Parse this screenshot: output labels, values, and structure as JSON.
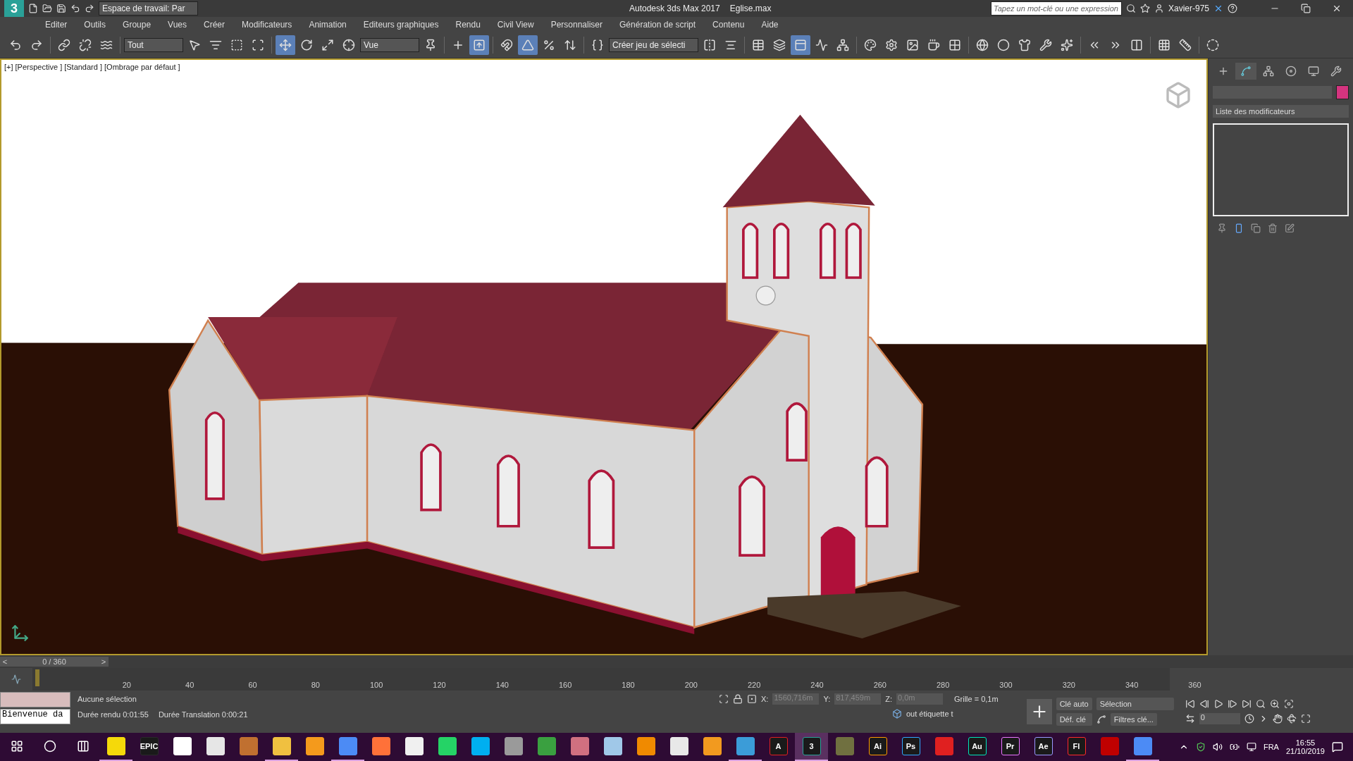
{
  "title_bar": {
    "logo": "3",
    "workspace": "Espace de travail: Par",
    "app_title": "Autodesk 3ds Max 2017",
    "file_name": "Eglise.max",
    "search": {
      "placeholder": "Tapez un mot-clé ou une expression"
    },
    "user": "Xavier-975"
  },
  "menu": [
    "Editer",
    "Outils",
    "Groupe",
    "Vues",
    "Créer",
    "Modificateurs",
    "Animation",
    "Editeurs graphiques",
    "Rendu",
    "Civil View",
    "Personnaliser",
    "Génération de script",
    "Contenu",
    "Aide"
  ],
  "toolbar": [
    {
      "kind": "undo",
      "selected": false
    },
    {
      "kind": "redo",
      "selected": false
    },
    {
      "kind": "sep"
    },
    {
      "kind": "link",
      "selected": false
    },
    {
      "kind": "unlink",
      "selected": false
    },
    {
      "kind": "bind",
      "selected": false
    },
    {
      "kind": "sep"
    },
    {
      "kind": "dropdown",
      "label": "Tout"
    },
    {
      "kind": "select",
      "selected": false
    },
    {
      "kind": "selectname",
      "selected": false
    },
    {
      "kind": "region",
      "selected": false
    },
    {
      "kind": "window",
      "selected": false
    },
    {
      "kind": "sep"
    },
    {
      "kind": "move",
      "selected": true
    },
    {
      "kind": "rotate",
      "selected": false
    },
    {
      "kind": "scale",
      "selected": false
    },
    {
      "kind": "place",
      "selected": false
    },
    {
      "kind": "dropdown",
      "label": "Vue"
    },
    {
      "kind": "pivot",
      "selected": false
    },
    {
      "kind": "sep"
    },
    {
      "kind": "manipulate",
      "selected": false
    },
    {
      "kind": "keyboard",
      "selected": true
    },
    {
      "kind": "sep"
    },
    {
      "kind": "snap",
      "selected": false
    },
    {
      "kind": "angle",
      "selected": true
    },
    {
      "kind": "percent",
      "selected": false
    },
    {
      "kind": "spinner",
      "selected": false
    },
    {
      "kind": "sep"
    },
    {
      "kind": "named",
      "selected": false
    },
    {
      "kind": "dropdown",
      "label": "Créer jeu de sélecti"
    },
    {
      "kind": "mirror",
      "selected": false
    },
    {
      "kind": "align",
      "selected": false
    },
    {
      "kind": "sep"
    },
    {
      "kind": "explorer",
      "selected": false
    },
    {
      "kind": "layers",
      "selected": false
    },
    {
      "kind": "ribbon",
      "selected": true
    },
    {
      "kind": "curve",
      "selected": false
    },
    {
      "kind": "schematic",
      "selected": false
    },
    {
      "kind": "sep"
    },
    {
      "kind": "material",
      "selected": false
    },
    {
      "kind": "rendersetup",
      "selected": false
    },
    {
      "kind": "frame",
      "selected": false
    },
    {
      "kind": "render",
      "selected": false
    },
    {
      "kind": "grid",
      "selected": false
    },
    {
      "kind": "sep"
    },
    {
      "kind": "web",
      "selected": false
    },
    {
      "kind": "sphere",
      "selected": false
    },
    {
      "kind": "shirt",
      "selected": false
    },
    {
      "kind": "pipe",
      "selected": false
    },
    {
      "kind": "spark",
      "selected": false
    },
    {
      "kind": "sep"
    },
    {
      "kind": "clipin",
      "selected": false
    },
    {
      "kind": "clipout",
      "selected": false
    },
    {
      "kind": "clipmid",
      "selected": false
    },
    {
      "kind": "sep"
    },
    {
      "kind": "dots",
      "selected": false
    },
    {
      "kind": "ruler",
      "selected": false
    },
    {
      "kind": "sep"
    },
    {
      "kind": "circle",
      "selected": false
    }
  ],
  "viewport": {
    "labels": [
      "[+]",
      "[Perspective ]",
      "[Standard ]",
      "[Ombrage par défaut ]"
    ]
  },
  "command_panel": {
    "tabs": [
      {
        "kind": "create",
        "selected": false
      },
      {
        "kind": "modify",
        "selected": true
      },
      {
        "kind": "hierarchy",
        "selected": false
      },
      {
        "kind": "motion",
        "selected": false
      },
      {
        "kind": "display",
        "selected": false
      },
      {
        "kind": "utilities",
        "selected": false
      }
    ],
    "modifier_list": "Liste des modificateurs"
  },
  "time_slider": {
    "prev": "<",
    "position": "0 / 360",
    "next": ">"
  },
  "timeline": {
    "labels": [
      "20",
      "40",
      "60",
      "80",
      "100",
      "120",
      "140",
      "160",
      "180",
      "200",
      "220",
      "240",
      "260",
      "280",
      "300",
      "320",
      "340",
      "360"
    ]
  },
  "status": {
    "listener": "Bienvenue da",
    "selection": "Aucune sélection",
    "render_time": "Durée rendu  0:01:55",
    "translation_time": "Durée Translation  0:00:21",
    "x_label": "X:",
    "x": "1560,716m",
    "y_label": "Y:",
    "y": "817,459m",
    "z_label": "Z:",
    "z": "0,0m",
    "grid": "Grille = 0,1m",
    "tag": "out étiquette t",
    "auto_key": "Clé auto",
    "set_key": "Déf. clé",
    "key_mode": "Sélection",
    "key_filters": "Filtres clé...",
    "frame": "0"
  },
  "taskbar": {
    "apps": [
      {
        "color": "#f5d90a",
        "running": true
      },
      {
        "color": "#2a2a2a",
        "label": "EPIC",
        "running": false
      },
      {
        "color": "#ffffff",
        "running": false
      },
      {
        "color": "#e6e6e6",
        "running": false
      },
      {
        "color": "#c07030",
        "running": false
      },
      {
        "color": "#f0c040",
        "running": true
      },
      {
        "color": "#f49a1c",
        "running": false
      },
      {
        "color": "#4c8bf5",
        "running": true
      },
      {
        "color": "#ff7139",
        "running": false
      },
      {
        "color": "#f0f0f0",
        "running": false
      },
      {
        "color": "#25d366",
        "running": false
      },
      {
        "color": "#00aff0",
        "running": false
      },
      {
        "color": "#9a9a9a",
        "running": false
      },
      {
        "color": "#3aa040",
        "running": false
      },
      {
        "color": "#d07080",
        "running": false
      },
      {
        "color": "#a0c8e8",
        "running": false
      },
      {
        "color": "#f08a00",
        "running": false
      },
      {
        "color": "#e8e8e8",
        "running": false
      },
      {
        "color": "#f29a1f",
        "running": false
      },
      {
        "color": "#3b9cd8",
        "running": true
      },
      {
        "color": "#e02020",
        "label": "A",
        "running": false
      },
      {
        "color": "#2aa198",
        "label": "3",
        "running": true
      },
      {
        "color": "#707040",
        "running": false
      },
      {
        "color": "#ff9a00",
        "label": "Ai",
        "running": false
      },
      {
        "color": "#31a8ff",
        "label": "Ps",
        "running": false
      },
      {
        "color": "#e02020",
        "running": false
      },
      {
        "color": "#00e4bb",
        "label": "Au",
        "running": false
      },
      {
        "color": "#ea77ff",
        "label": "Pr",
        "running": false
      },
      {
        "color": "#9999ff",
        "label": "Ae",
        "running": false
      },
      {
        "color": "#ff2a2a",
        "label": "Fl",
        "running": false
      },
      {
        "color": "#bf0000",
        "running": false
      },
      {
        "color": "#4c8bf5",
        "running": true
      }
    ],
    "language": "FRA",
    "time": "16:55",
    "date": "21/10/2019"
  }
}
